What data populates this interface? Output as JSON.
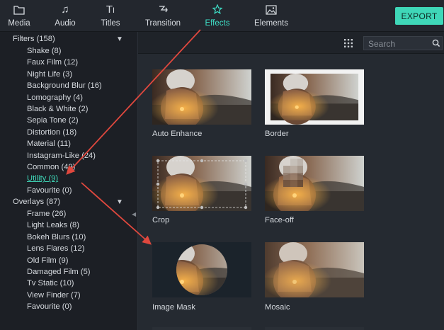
{
  "tabs": [
    {
      "label": "Media",
      "icon": "folder-icon"
    },
    {
      "label": "Audio",
      "icon": "music-note-icon"
    },
    {
      "label": "Titles",
      "icon": "text-icon"
    },
    {
      "label": "Transition",
      "icon": "transition-icon"
    },
    {
      "label": "Effects",
      "icon": "effects-icon",
      "active": true
    },
    {
      "label": "Elements",
      "icon": "image-icon"
    }
  ],
  "export_label": "EXPORT",
  "accent_color": "#3fd7b8",
  "arrow_color": "#e0483e",
  "sidebar": {
    "filters": {
      "label": "Filters (158)",
      "items": [
        "Shake (8)",
        "Faux Film (12)",
        "Night Life (3)",
        "Background Blur (16)",
        "Lomography (4)",
        "Black & White (2)",
        "Sepia Tone (2)",
        "Distortion (18)",
        "Material (11)",
        "Instagram-Like (24)",
        "Common (49)",
        "Utility (9)",
        "Favourite (0)"
      ],
      "selected": "Utility (9)"
    },
    "overlays": {
      "label": "Overlays (87)",
      "items": [
        "Frame (26)",
        "Light Leaks (8)",
        "Bokeh Blurs (10)",
        "Lens Flares (12)",
        "Old Film (9)",
        "Damaged Film (5)",
        "Tv Static (10)",
        "View Finder (7)",
        "Favourite (0)"
      ]
    }
  },
  "search": {
    "placeholder": "Search"
  },
  "effects": [
    "Auto Enhance",
    "Border",
    "Crop",
    "Face-off",
    "Image Mask",
    "Mosaic"
  ]
}
